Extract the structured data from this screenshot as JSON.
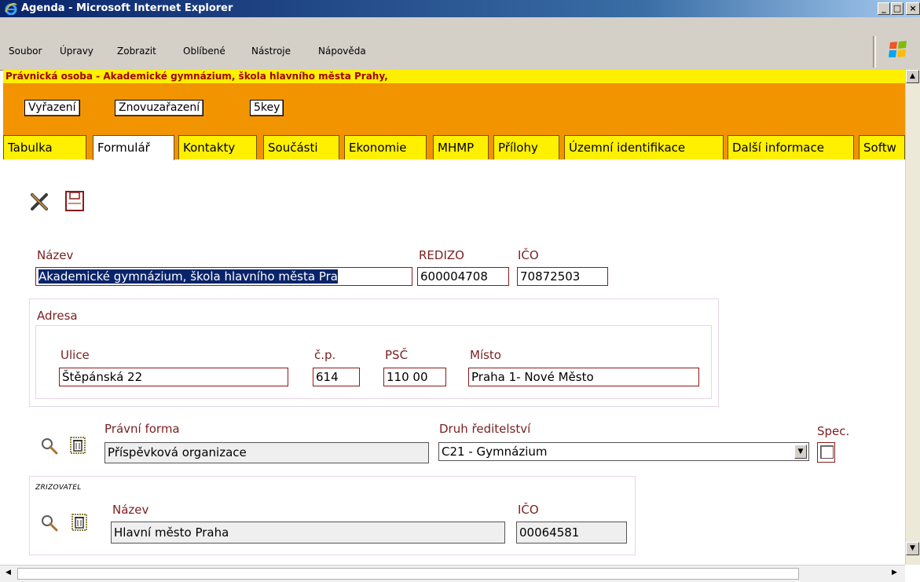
{
  "window": {
    "title": "Agenda - Microsoft Internet Explorer",
    "min_glyph": "_",
    "max_glyph": "□",
    "close_glyph": "×"
  },
  "menu": {
    "items": [
      "Soubor",
      "Úpravy",
      "Zobrazit",
      "Oblíbené",
      "Nástroje",
      "Nápověda"
    ]
  },
  "header": {
    "title": "Právnická osoba - Akademické gymnázium, škola hlavního města Prahy,",
    "buttons": [
      "Vyřazení",
      "Znovuzařazení",
      "5key"
    ]
  },
  "tabs": {
    "items": [
      "Tabulka",
      "Formulář",
      "Kontakty",
      "Součásti",
      "Ekonomie",
      "MHMP",
      "Přílohy",
      "Územní identifikace",
      "Další informace",
      "Softw"
    ],
    "active": "Formulář"
  },
  "toolbar": {
    "icons": [
      "delete-icon",
      "save-icon"
    ]
  },
  "form": {
    "nazev_label": "Název",
    "nazev_value": "Akademické gymnázium, škola hlavního města Pra",
    "redizo_label": "REDIZO",
    "redizo_value": "600004708",
    "ico_label": "IČO",
    "ico_value": "70872503",
    "adresa": {
      "title": "Adresa",
      "ulice_label": "Ulice",
      "ulice_value": "Štěpánská 22",
      "cp_label": "č.p.",
      "cp_value": "614",
      "psc_label": "PSČ",
      "psc_value": "110 00",
      "misto_label": "Místo",
      "misto_value": "Praha 1- Nové Město"
    },
    "pravni_forma_label": "Právní forma",
    "pravni_forma_value": "Příspěvková organizace",
    "druh_label": "Druh ředitelství",
    "druh_value": "C21 - Gymnázium",
    "spec_label": "Spec.",
    "spec_checked": false,
    "zrizovatel": {
      "title": "ZRIZOVATEL",
      "nazev_label": "Název",
      "nazev_value": "Hlavní město Praha",
      "ico_label": "IČO",
      "ico_value": "00064581"
    }
  },
  "colors": {
    "header_orange": "#f29400",
    "tab_yellow": "#fff000",
    "label_red": "#7a1f1f",
    "title_blue": "#0a246a"
  }
}
